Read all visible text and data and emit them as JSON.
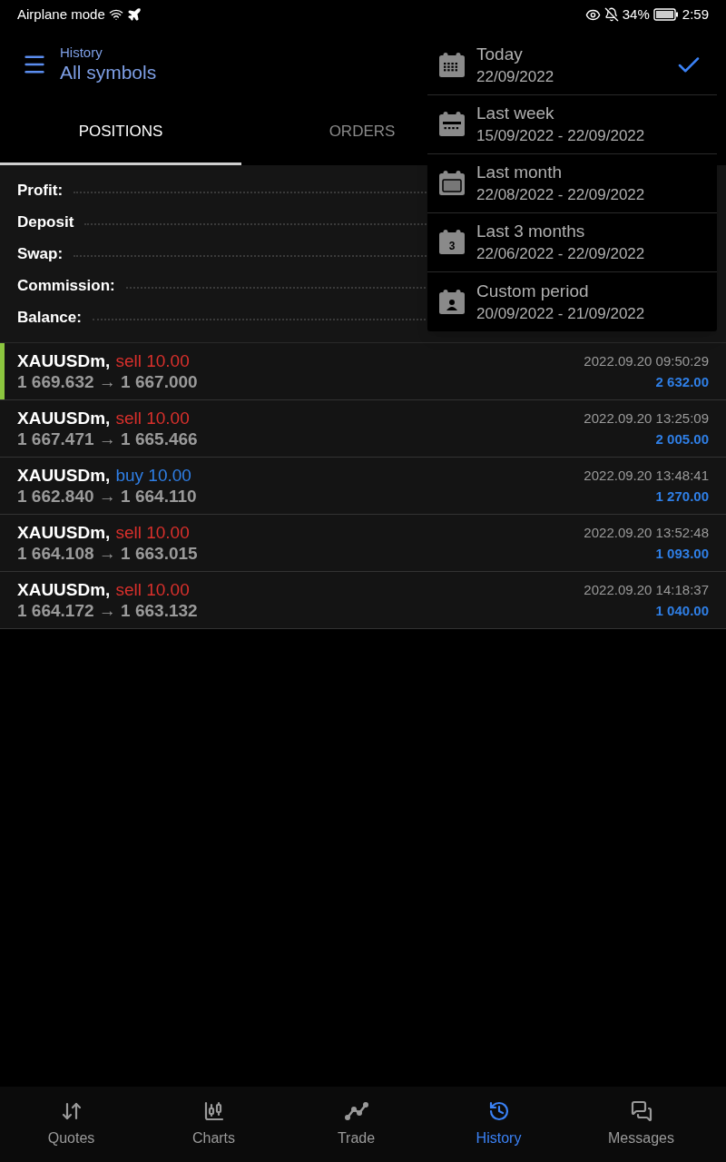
{
  "status_bar": {
    "left": "Airplane mode",
    "battery": "34%",
    "time": "2:59"
  },
  "header": {
    "subtitle": "History",
    "title": "All symbols"
  },
  "tabs": [
    {
      "label": "POSITIONS",
      "selected": true
    },
    {
      "label": "ORDERS",
      "selected": false
    }
  ],
  "summary": [
    {
      "label": "Profit:"
    },
    {
      "label": "Deposit"
    },
    {
      "label": "Swap:"
    },
    {
      "label": "Commission:"
    },
    {
      "label": "Balance:"
    }
  ],
  "positions": [
    {
      "symbol": "XAUUSDm,",
      "kind": "sell",
      "trade": "sell 10.00",
      "prices": "1 669.632 → 1 667.000",
      "time": "2022.09.20 09:50:29",
      "profit": "2 632.00",
      "selected": true
    },
    {
      "symbol": "XAUUSDm,",
      "kind": "sell",
      "trade": "sell 10.00",
      "prices": "1 667.471 → 1 665.466",
      "time": "2022.09.20 13:25:09",
      "profit": "2 005.00",
      "selected": false
    },
    {
      "symbol": "XAUUSDm,",
      "kind": "buy",
      "trade": "buy 10.00",
      "prices": "1 662.840 → 1 664.110",
      "time": "2022.09.20 13:48:41",
      "profit": "1 270.00",
      "selected": false
    },
    {
      "symbol": "XAUUSDm,",
      "kind": "sell",
      "trade": "sell 10.00",
      "prices": "1 664.108 → 1 663.015",
      "time": "2022.09.20 13:52:48",
      "profit": "1 093.00",
      "selected": false
    },
    {
      "symbol": "XAUUSDm,",
      "kind": "sell",
      "trade": "sell 10.00",
      "prices": "1 664.172 → 1 663.132",
      "time": "2022.09.20 14:18:37",
      "profit": "1 040.00",
      "selected": false
    }
  ],
  "period_menu": [
    {
      "kind": "day",
      "label": "Today",
      "range": "22/09/2022",
      "selected": true
    },
    {
      "kind": "week",
      "label": "Last week",
      "range": "15/09/2022 - 22/09/2022",
      "selected": false
    },
    {
      "kind": "month",
      "label": "Last month",
      "range": "22/08/2022 - 22/09/2022",
      "selected": false
    },
    {
      "kind": "three",
      "label": "Last 3 months",
      "range": "22/06/2022 - 22/09/2022",
      "selected": false,
      "icon_text": "3"
    },
    {
      "kind": "custom",
      "label": "Custom period",
      "range": "20/09/2022 - 21/09/2022",
      "selected": false
    }
  ],
  "bottom_nav": [
    {
      "kind": "quotes",
      "label": "Quotes",
      "selected": false
    },
    {
      "kind": "charts",
      "label": "Charts",
      "selected": false
    },
    {
      "kind": "trade",
      "label": "Trade",
      "selected": false
    },
    {
      "kind": "history",
      "label": "History",
      "selected": true
    },
    {
      "kind": "messages",
      "label": "Messages",
      "selected": false
    }
  ]
}
